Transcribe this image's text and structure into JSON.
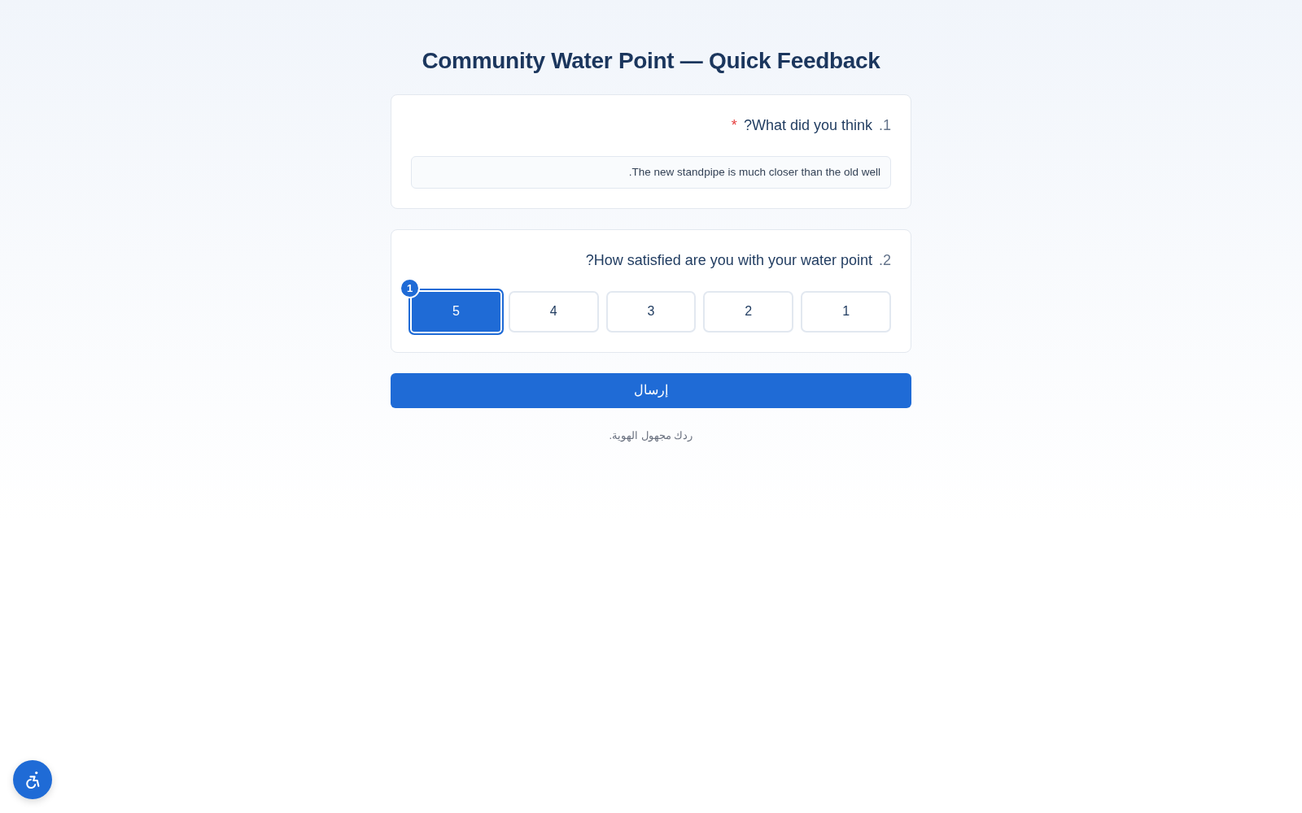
{
  "title": "Community Water Point — Quick Feedback",
  "questions": [
    {
      "kind": "text",
      "number": "1.",
      "label": "What did you think?",
      "required_mark": "*",
      "value": "The new standpipe is much closer than the old well."
    },
    {
      "kind": "scale",
      "number": "2.",
      "label": "How satisfied are you with your water point?",
      "options": [
        {
          "label": "1",
          "selected": false
        },
        {
          "label": "2",
          "selected": false
        },
        {
          "label": "3",
          "selected": false
        },
        {
          "label": "4",
          "selected": false
        },
        {
          "label": "5",
          "selected": true,
          "badge": "1"
        }
      ]
    }
  ],
  "submit_button": "إرسال",
  "footnote": "ردك مجهول الهوية."
}
